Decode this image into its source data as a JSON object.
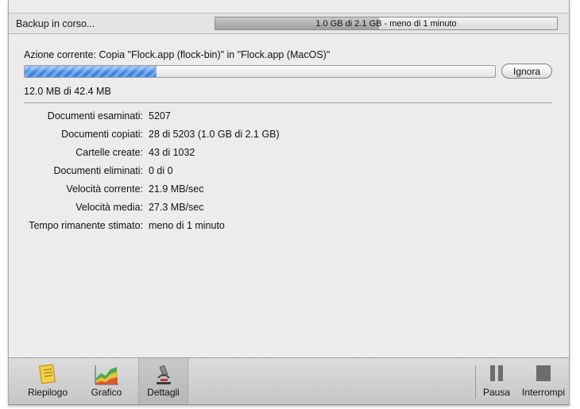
{
  "status": {
    "text": "Backup in corso...",
    "overall_progress_text": "1.0 GB di 2.1 GB - meno di 1 minuto",
    "overall_progress_fraction": 0.48
  },
  "current": {
    "action_label": "Azione corrente:",
    "action_text": "Copia \"Flock.app (flock-bin)\" in \"Flock.app (MacOS)\"",
    "file_progress_fraction": 0.28,
    "ignore_button": "Ignora",
    "size_text": "12.0 MB di 42.4 MB"
  },
  "details": [
    {
      "label": "Documenti esaminati:",
      "value": "5207"
    },
    {
      "label": "Documenti copiati:",
      "value": "28 di 5203 (1.0 GB di 2.1 GB)"
    },
    {
      "label": "Cartelle create:",
      "value": "43 di 1032"
    },
    {
      "label": "Documenti eliminati:",
      "value": "0 di 0"
    },
    {
      "label": "Velocità corrente:",
      "value": "21.9 MB/sec"
    },
    {
      "label": "Velocità media:",
      "value": "27.3 MB/sec"
    },
    {
      "label": "Tempo rimanente stimato:",
      "value": "meno di 1 minuto"
    }
  ],
  "toolbar": {
    "summary": "Riepilogo",
    "chart": "Grafico",
    "details": "Dettagli",
    "pause": "Pausa",
    "stop": "Interrompi",
    "selected": "details"
  },
  "colors": {
    "progress_blue": "#3c82dd",
    "window_bg": "#ececec"
  }
}
